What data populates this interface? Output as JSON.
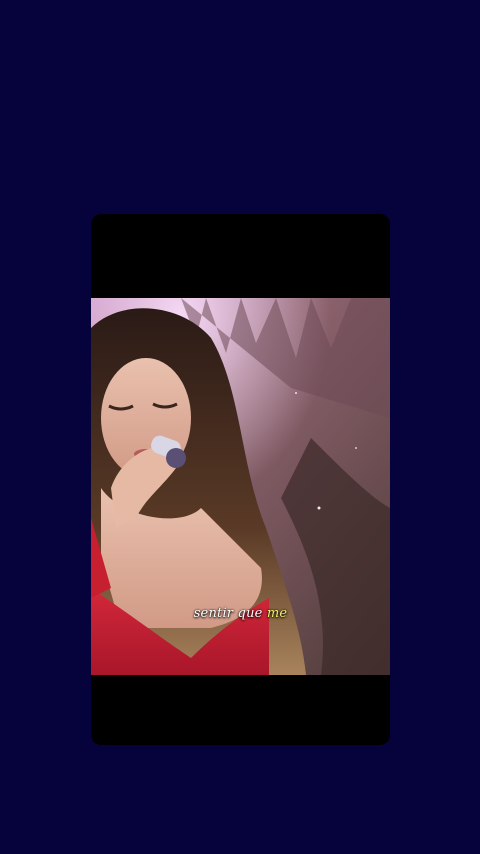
{
  "lyric": {
    "text": "sentir que",
    "highlight": "me",
    "highlight_color": "#f2f06a"
  },
  "colors": {
    "background": "#06033c",
    "card": "#000000",
    "dress": "#c61f2f"
  },
  "video": {
    "description_icon": "singer-performance-video"
  }
}
